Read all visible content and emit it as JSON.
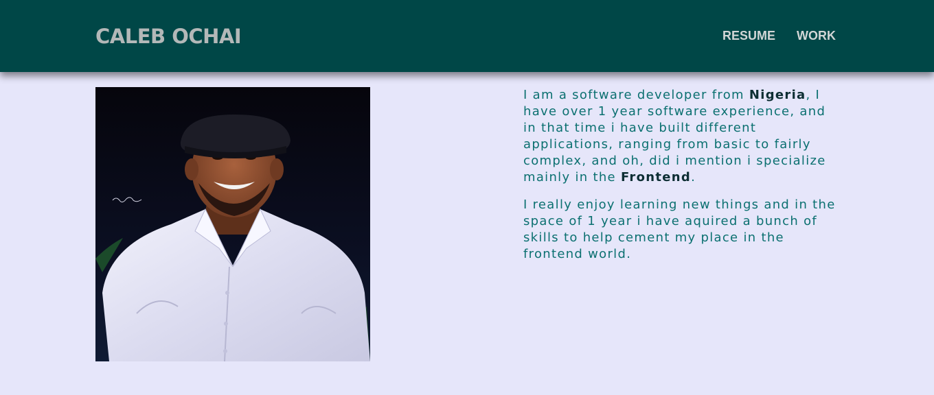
{
  "header": {
    "brand": "CALEB OCHAI",
    "nav": [
      {
        "label": "RESUME"
      },
      {
        "label": "WORK"
      }
    ]
  },
  "about": {
    "paragraph1": {
      "before": "I am a software developer from ",
      "highlight1": "Nigeria",
      "middle": ", I have over 1 year software experience, and in that time i have built different applications, ranging from basic to fairly complex, and oh, did i mention i specialize mainly in the ",
      "highlight2": "Frontend",
      "after": "."
    },
    "paragraph2": "I really enjoy learning new things and in the space of 1 year i have aquired a bunch of skills to help cement my place in the frontend world."
  },
  "colors": {
    "navbar": "#004747",
    "background": "#e6e6fa",
    "text": "#0b7070",
    "highlight": "#0d2e33"
  }
}
